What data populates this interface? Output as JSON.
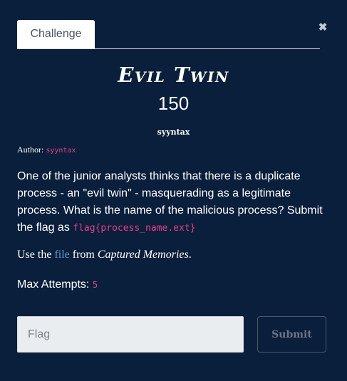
{
  "tab": {
    "label": "Challenge"
  },
  "close": {
    "glyph": "✖"
  },
  "challenge": {
    "name": "Evil Twin",
    "points": "150",
    "category": "syyntax",
    "author_label": "Author:",
    "author": "syyntax",
    "description_text": "One of the junior analysts thinks that there is a duplicate process - an \"evil twin\" - masquerading as a legitimate process. What is the name of the malicious process? Submit the flag as",
    "flag_format": "flag{process_name.ext}",
    "use_the": "Use the",
    "file_link": "file",
    "from": "from",
    "source": "Captured Memories",
    "period": ".",
    "max_attempts_label": "Max Attempts:",
    "max_attempts": "5"
  },
  "form": {
    "placeholder": "Flag",
    "submit_label": "Submit"
  },
  "colors": {
    "background": "#0a1f3b",
    "accent_pink": "#e83e8c",
    "link_blue": "#5b9bd5"
  }
}
